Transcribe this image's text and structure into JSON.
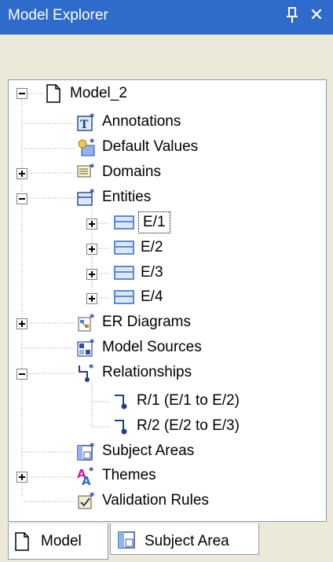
{
  "window": {
    "title": "Model Explorer",
    "pin_icon": "pin-icon",
    "close_label": "✕"
  },
  "tree": {
    "root": {
      "label": "Model_2",
      "icon": "document-icon",
      "expanded": true
    },
    "items": [
      {
        "label": "Annotations",
        "icon": "annotations-icon",
        "expander": "none"
      },
      {
        "label": "Default Values",
        "icon": "default-values-icon",
        "expander": "none"
      },
      {
        "label": "Domains",
        "icon": "domains-icon",
        "expander": "plus"
      },
      {
        "label": "Entities",
        "icon": "entities-icon",
        "expander": "minus"
      },
      {
        "label": "E/1",
        "icon": "entity-icon",
        "expander": "plus",
        "selected": true
      },
      {
        "label": "E/2",
        "icon": "entity-icon",
        "expander": "plus"
      },
      {
        "label": "E/3",
        "icon": "entity-icon",
        "expander": "plus"
      },
      {
        "label": "E/4",
        "icon": "entity-icon",
        "expander": "plus"
      },
      {
        "label": "ER Diagrams",
        "icon": "er-diagrams-icon",
        "expander": "plus"
      },
      {
        "label": "Model Sources",
        "icon": "model-sources-icon",
        "expander": "none"
      },
      {
        "label": "Relationships",
        "icon": "relationships-icon",
        "expander": "minus"
      },
      {
        "label": "R/1 (E/1 to E/2)",
        "icon": "relationship-icon",
        "expander": "none"
      },
      {
        "label": "R/2 (E/2 to E/3)",
        "icon": "relationship-icon",
        "expander": "none"
      },
      {
        "label": "Subject Areas",
        "icon": "subject-areas-icon",
        "expander": "none"
      },
      {
        "label": "Themes",
        "icon": "themes-icon",
        "expander": "plus"
      },
      {
        "label": "Validation Rules",
        "icon": "validation-rules-icon",
        "expander": "none"
      }
    ]
  },
  "tabs": [
    {
      "label": "Model",
      "icon": "document-icon",
      "active": true
    },
    {
      "label": "Subject Area",
      "icon": "subject-area-icon",
      "active": false
    }
  ],
  "colors": {
    "titlebar": "#2f6bcb",
    "panel": "#ece9d8",
    "border": "#7f9db9",
    "entity_blue": "#4f7ed6"
  }
}
